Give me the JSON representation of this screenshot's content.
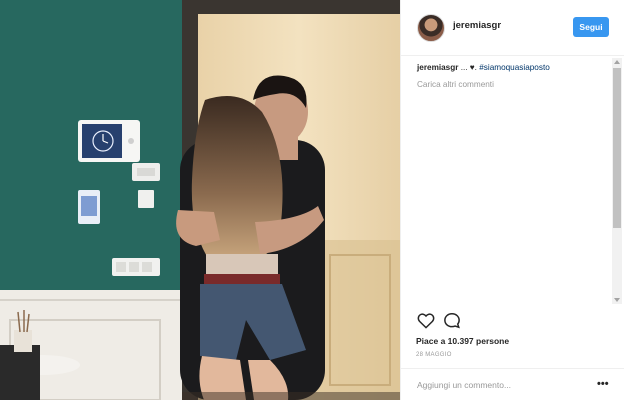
{
  "post": {
    "author": {
      "username": "jeremiasgr",
      "follow_label": "Segui"
    },
    "caption": {
      "username": "jeremiasgr",
      "prefix": " ... ",
      "heart": "♥",
      "suffix": ". ",
      "hashtag": "#siamoquasiaposto"
    },
    "load_more_label": "Carica altri commenti",
    "likes_label": "Piace a 10.397 persone",
    "date_label": "28 MAGGIO",
    "comment_placeholder": "Aggiungi un commento...",
    "more_options_label": "•••"
  },
  "icons": {
    "like": "heart-icon",
    "comment": "comment-icon",
    "options": "more-options-icon"
  },
  "colors": {
    "follow_button": "#3897f0",
    "hashtag": "#003569",
    "muted_text": "#999999",
    "wall": "#2b6f66"
  }
}
